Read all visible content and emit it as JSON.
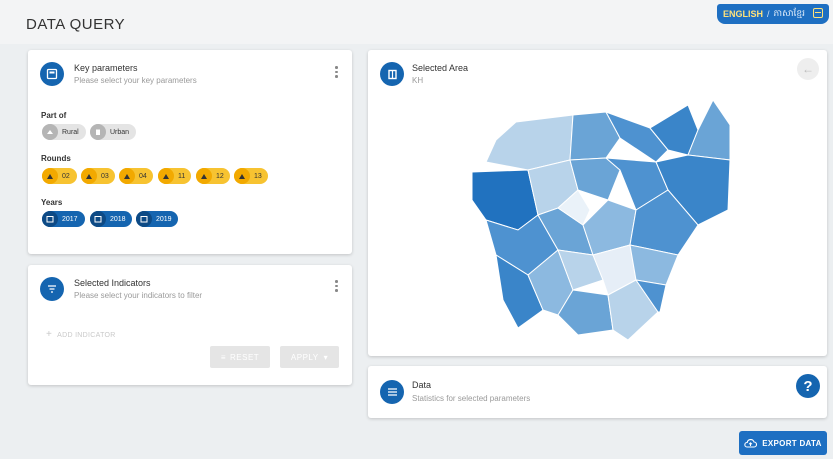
{
  "page": {
    "title": "DATA QUERY"
  },
  "language": {
    "english": "ENGLISH",
    "separator": "/",
    "khmer": "ភាសាខ្មែរ"
  },
  "key_parameters": {
    "title": "Key parameters",
    "subtitle": "Please select your key parameters",
    "part_of": {
      "label": "Part of",
      "options": [
        "Rural",
        "Urban"
      ]
    },
    "rounds": {
      "label": "Rounds",
      "options": [
        "02",
        "03",
        "04",
        "11",
        "12",
        "13"
      ]
    },
    "years": {
      "label": "Years",
      "options": [
        "2017",
        "2018",
        "2019"
      ]
    }
  },
  "selected_indicators": {
    "title": "Selected Indicators",
    "subtitle": "Please select your indicators to filter",
    "add_label": "ADD INDICATOR",
    "reset_label": "RESET",
    "apply_label": "APPLY"
  },
  "selected_area": {
    "title": "Selected Area",
    "value": "KH"
  },
  "data_panel": {
    "title": "Data",
    "subtitle": "Statistics for selected parameters",
    "help": "?"
  },
  "export_label": "EXPORT DATA",
  "colors": {
    "primary": "#1565b0",
    "chip_yellow": "#f7c331",
    "chip_grey": "#e4e4e4"
  },
  "icons": [
    "book-icon",
    "map-icon",
    "filter-icon",
    "list-icon",
    "calendar-icon",
    "cloud-upload-icon",
    "arrow-left-icon",
    "exit-icon"
  ]
}
